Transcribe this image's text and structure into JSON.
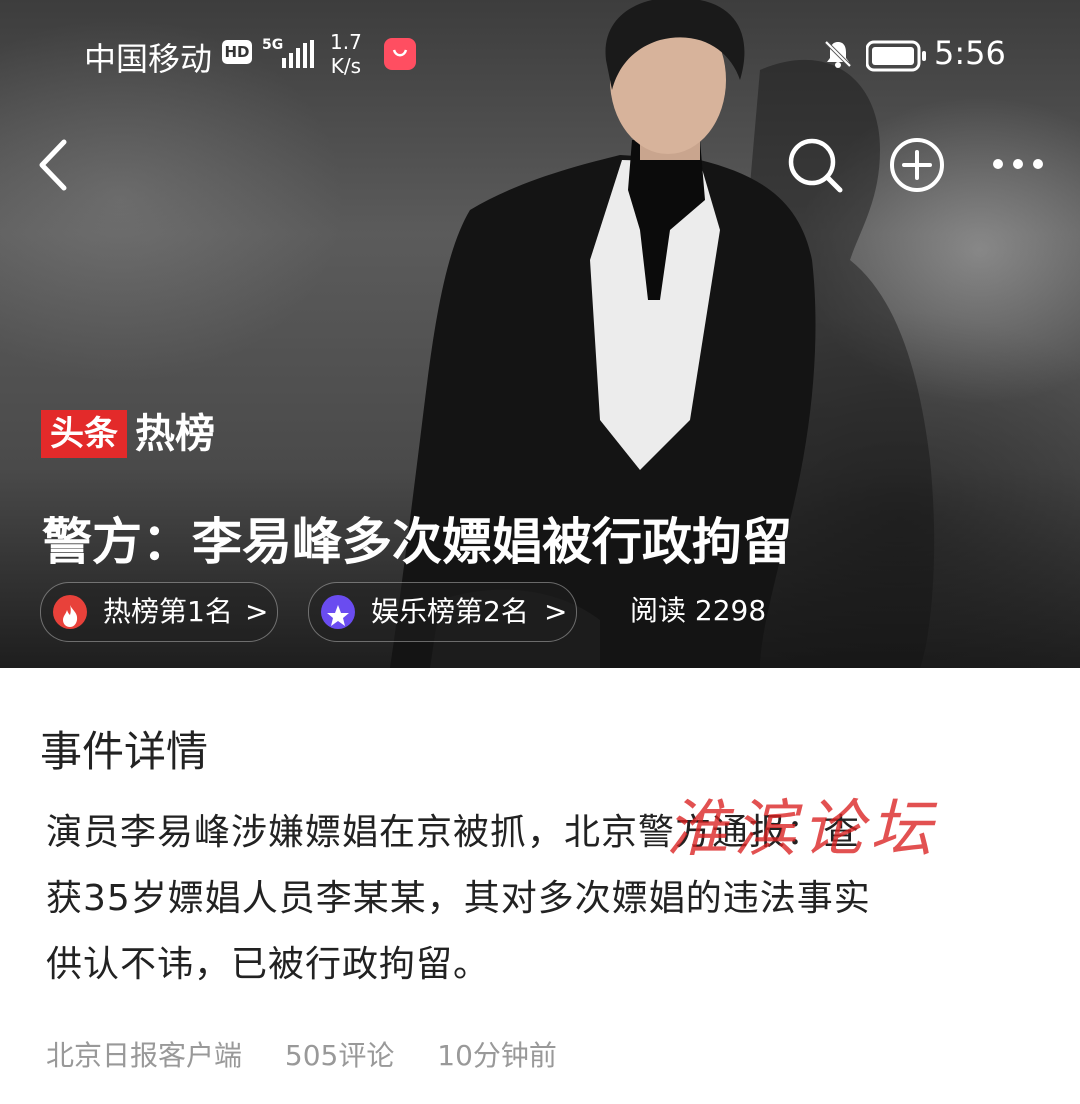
{
  "status_bar": {
    "carrier": "中国移动",
    "hd": "HD",
    "network": "5G",
    "speed_value": "1.7",
    "speed_unit": "K/s",
    "time": "5:56"
  },
  "nav": {
    "back_icon": "back-arrow-icon",
    "search_icon": "search-icon",
    "add_icon": "add-circle-icon",
    "more_icon": "more-icon"
  },
  "brand": {
    "red_text": "头条",
    "white_text": "热榜",
    "red_color": "#e32a2a"
  },
  "headline": "警方：李易峰多次嫖娼被行政拘留",
  "badges": [
    {
      "label": "热榜第1名",
      "icon": "fire-icon",
      "color": "#e8413a"
    },
    {
      "label": "娱乐榜第2名",
      "icon": "star-icon",
      "color": "#6a4cf0"
    }
  ],
  "chevron": ">",
  "reads": "阅读 2298",
  "section_title": "事件详情",
  "body_lines": [
    "演员李易峰涉嫌嫖娼在京被抓，北京警方通报：查",
    "获35岁嫖娼人员李某某，其对多次嫖娼的违法事实",
    "供认不讳，已被行政拘留。"
  ],
  "watermark": "淮滨论坛",
  "meta": {
    "source": "北京日报客户端",
    "comments": "505评论",
    "time_ago": "10分钟前"
  }
}
